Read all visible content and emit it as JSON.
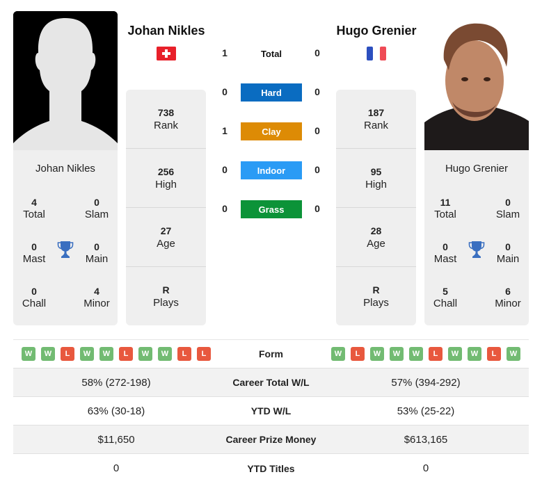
{
  "player1": {
    "name": "Johan Nikles",
    "country": "Switzerland",
    "flag_colors": {
      "bg": "#e8202a",
      "cross": "#ffffff"
    },
    "rank": "738",
    "rank_label": "Rank",
    "high": "256",
    "high_label": "High",
    "age": "27",
    "age_label": "Age",
    "plays": "R",
    "plays_label": "Plays",
    "titles": {
      "total": "4",
      "total_label": "Total",
      "slam": "0",
      "slam_label": "Slam",
      "mast": "0",
      "mast_label": "Mast",
      "main": "0",
      "main_label": "Main",
      "chall": "0",
      "chall_label": "Chall",
      "minor": "4",
      "minor_label": "Minor"
    },
    "form": [
      "W",
      "W",
      "L",
      "W",
      "W",
      "L",
      "W",
      "W",
      "L",
      "L"
    ],
    "career_wl": "58% (272-198)",
    "ytd_wl": "63% (30-18)",
    "prize_money": "$11,650",
    "ytd_titles": "0"
  },
  "player2": {
    "name": "Hugo Grenier",
    "country": "France",
    "flag_colors": {
      "blue": "#2c4fbf",
      "white": "#ffffff",
      "red": "#ef4b56"
    },
    "rank": "187",
    "rank_label": "Rank",
    "high": "95",
    "high_label": "High",
    "age": "28",
    "age_label": "Age",
    "plays": "R",
    "plays_label": "Plays",
    "titles": {
      "total": "11",
      "total_label": "Total",
      "slam": "0",
      "slam_label": "Slam",
      "mast": "0",
      "mast_label": "Mast",
      "main": "0",
      "main_label": "Main",
      "chall": "5",
      "chall_label": "Chall",
      "minor": "6",
      "minor_label": "Minor"
    },
    "form": [
      "W",
      "L",
      "W",
      "W",
      "W",
      "L",
      "W",
      "W",
      "L",
      "W"
    ],
    "career_wl": "57% (394-292)",
    "ytd_wl": "53% (25-22)",
    "prize_money": "$613,165",
    "ytd_titles": "0"
  },
  "h2h": [
    {
      "label": "Total",
      "p1": "1",
      "p2": "0",
      "color": ""
    },
    {
      "label": "Hard",
      "p1": "0",
      "p2": "0",
      "color": "#0a6cc1"
    },
    {
      "label": "Clay",
      "p1": "1",
      "p2": "0",
      "color": "#dd8b05"
    },
    {
      "label": "Indoor",
      "p1": "0",
      "p2": "0",
      "color": "#2a9bf5"
    },
    {
      "label": "Grass",
      "p1": "0",
      "p2": "0",
      "color": "#0c9338"
    }
  ],
  "comparison": {
    "form_label": "Form",
    "career_wl_label": "Career Total W/L",
    "ytd_wl_label": "YTD W/L",
    "prize_label": "Career Prize Money",
    "ytd_titles_label": "YTD Titles"
  },
  "colors": {
    "win": "#72bb72",
    "loss": "#e8583e",
    "trophy": "#3a6fc0"
  }
}
